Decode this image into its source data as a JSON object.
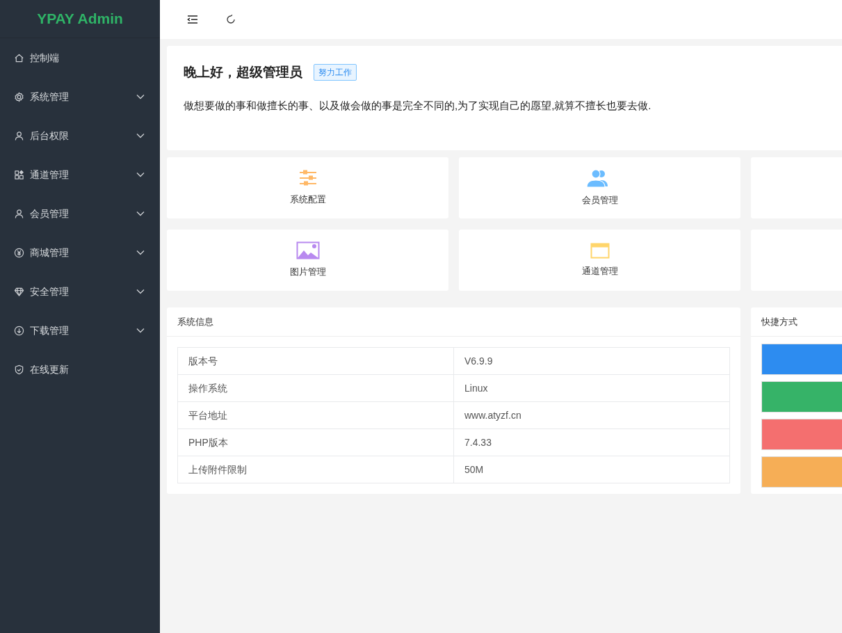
{
  "brand": "YPAY Admin",
  "sidebar": {
    "items": [
      {
        "label": "控制端",
        "expandable": false
      },
      {
        "label": "系统管理",
        "expandable": true
      },
      {
        "label": "后台权限",
        "expandable": true
      },
      {
        "label": "通道管理",
        "expandable": true
      },
      {
        "label": "会员管理",
        "expandable": true
      },
      {
        "label": "商城管理",
        "expandable": true
      },
      {
        "label": "安全管理",
        "expandable": true
      },
      {
        "label": "下载管理",
        "expandable": true
      },
      {
        "label": "在线更新",
        "expandable": false
      }
    ]
  },
  "greeting": {
    "title": "晚上好，超级管理员",
    "tag": "努力工作",
    "quote": "做想要做的事和做擅长的事、以及做会做的事是完全不同的,为了实现自己的愿望,就算不擅长也要去做."
  },
  "quick_links": [
    {
      "color": "#ffb866",
      "label": "系统配置"
    },
    {
      "color": "#6bbcff",
      "label": "会员管理"
    },
    {
      "color": "#b889ef",
      "label": "图片管理"
    },
    {
      "color": "#ffd56b",
      "label": "通道管理"
    }
  ],
  "system_info": {
    "title": "系统信息",
    "rows": [
      {
        "label": "版本号",
        "value": "V6.9.9"
      },
      {
        "label": "操作系统",
        "value": "Linux"
      },
      {
        "label": "平台地址",
        "value": "www.atyzf.cn"
      },
      {
        "label": "PHP版本",
        "value": "7.4.33"
      },
      {
        "label": "上传附件限制",
        "value": "50M"
      }
    ]
  },
  "shortcuts": {
    "title": "快捷方式",
    "buttons": [
      {
        "color": "#2d8cf0"
      },
      {
        "color": "#36b368"
      },
      {
        "color": "#f46f6f"
      },
      {
        "color": "#f6ae56"
      }
    ]
  }
}
